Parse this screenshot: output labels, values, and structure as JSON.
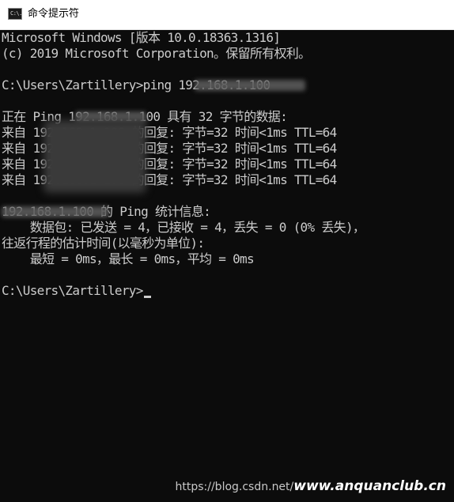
{
  "window": {
    "title": "命令提示符",
    "icon": "cmd-icon",
    "icon_text": "C:\\."
  },
  "terminal": {
    "lines": [
      "Microsoft Windows [版本 10.0.18363.1316]",
      "(c) 2019 Microsoft Corporation。保留所有权利。",
      "",
      "C:\\Users\\Zartillery>ping 192.168.1.100",
      "",
      "正在 Ping 192.168.1.100 具有 32 字节的数据:",
      "来自 192.168.1.100 的回复: 字节=32 时间<1ms TTL=64",
      "来自 192.168.1.100 的回复: 字节=32 时间<1ms TTL=64",
      "来自 192.168.1.100 的回复: 字节=32 时间<1ms TTL=64",
      "来自 192.168.1.100 的回复: 字节=32 时间<1ms TTL=64",
      "",
      "192.168.1.100 的 Ping 统计信息:",
      "    数据包: 已发送 = 4，已接收 = 4，丢失 = 0 (0% 丢失)，",
      "往返行程的估计时间(以毫秒为单位):",
      "    最短 = 0ms，最长 = 0ms，平均 = 0ms",
      ""
    ],
    "prompt": "C:\\Users\\Zartillery>"
  },
  "watermark": {
    "url": "https://blog.csdn.net/",
    "brand": "www.anquanclub.cn"
  },
  "colors": {
    "terminal_bg": "#0c0c0c",
    "terminal_fg": "#cccccc",
    "titlebar_bg": "#ffffff"
  }
}
